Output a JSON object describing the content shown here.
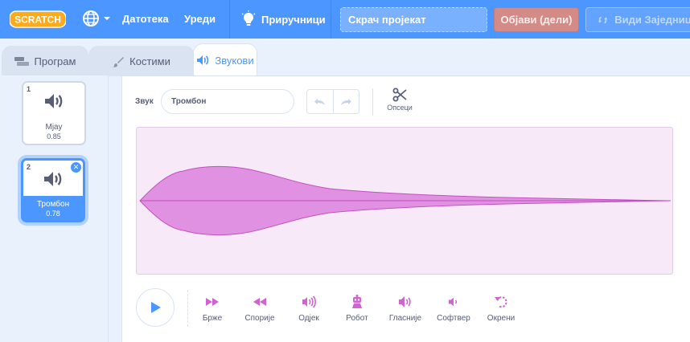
{
  "menubar": {
    "logo_text": "SCRATCH",
    "file_label": "Датотека",
    "edit_label": "Уреди",
    "tutorials_label": "Приручници",
    "project_title": "Скрач пројекат",
    "share_label": "Објави (дели)",
    "community_label": "Види Заједницу"
  },
  "tabs": [
    {
      "label": "Програм"
    },
    {
      "label": "Костими"
    },
    {
      "label": "Звукови"
    }
  ],
  "sounds": [
    {
      "index": "1",
      "name": "Мјау",
      "duration": "0.85"
    },
    {
      "index": "2",
      "name": "Тромбон",
      "duration": "0.78"
    }
  ],
  "editor": {
    "sound_label": "Звук",
    "sound_name": "Тромбон",
    "trim_label": "Опсеци",
    "effects": [
      {
        "label": "Брже",
        "icon": "faster-icon"
      },
      {
        "label": "Спорије",
        "icon": "slower-icon"
      },
      {
        "label": "Одјек",
        "icon": "echo-icon"
      },
      {
        "label": "Робот",
        "icon": "robot-icon"
      },
      {
        "label": "Гласније",
        "icon": "louder-icon"
      },
      {
        "label": "Софтвер",
        "icon": "softer-icon"
      },
      {
        "label": "Окрени",
        "icon": "reverse-icon"
      }
    ]
  },
  "colors": {
    "menubar": "#4c97ff",
    "accent": "#4c97ff",
    "effects": "#cf63cf",
    "waveform_fill": "#e191e1",
    "waveform_stroke": "#c34fc3",
    "share": "#d48a87"
  }
}
